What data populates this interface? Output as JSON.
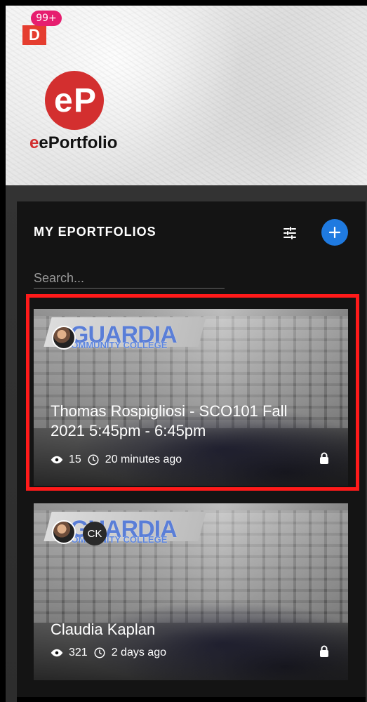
{
  "app": {
    "notification_count": "99+",
    "badge_letter": "D",
    "logo_text": "ePortfolio"
  },
  "colors": {
    "accent": "#1f7ae0",
    "brand": "#d32f2f",
    "badge": "#e61e6f",
    "highlight": "#ff1a1a"
  },
  "panel": {
    "title": "MY EPORTFOLIOS",
    "search_placeholder": "Search..."
  },
  "cards": [
    {
      "title": "Thomas Rospigliosi - SCO101 Fall 2021 5:45pm - 6:45pm",
      "views": "15",
      "time": "20 minutes ago",
      "banner": "GUARDIA",
      "banner_sub": "COMMUNITY COLLEGE"
    },
    {
      "title": "Claudia Kaplan",
      "views": "321",
      "time": "2 days ago",
      "initials": "CK",
      "banner": "GUARDIA",
      "banner_sub": "COMMUNITY COLLEGE"
    }
  ],
  "icons": {
    "filter": "filter-icon",
    "add": "plus-icon",
    "eye": "eye-icon",
    "clock": "clock-icon",
    "lock": "lock-icon"
  }
}
